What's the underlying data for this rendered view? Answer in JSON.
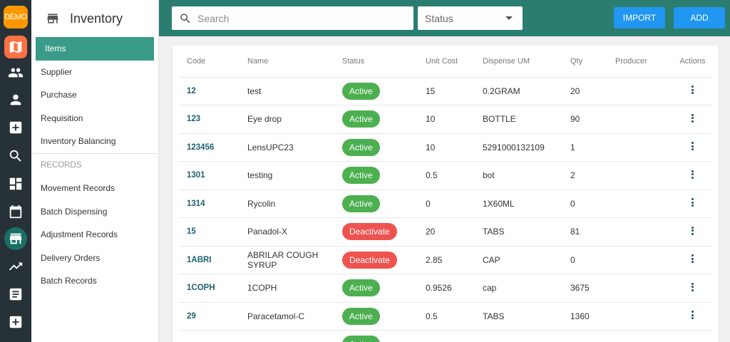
{
  "rail": {
    "demo_label": "DEMO",
    "icons": [
      "map-icon",
      "users-icon",
      "person-icon",
      "medical-plus-icon",
      "search-icon",
      "dashboard-icon",
      "calendar-icon",
      "store-icon",
      "trending-icon",
      "receipt-icon",
      "medical-plus-icon"
    ],
    "active_icon": "store-icon",
    "colors": {
      "rail_bg": "#263238",
      "demo": "#ff9800",
      "map": "#ff7043",
      "active": "#1b6f65"
    }
  },
  "sidebar": {
    "title": "Inventory",
    "items": [
      {
        "label": "Items",
        "active": true
      },
      {
        "label": "Supplier"
      },
      {
        "label": "Purchase"
      },
      {
        "label": "Requisition"
      },
      {
        "label": "Inventory Balancing"
      }
    ],
    "records_section": {
      "label": "RECORDS",
      "items": [
        {
          "label": "Movement Records"
        },
        {
          "label": "Batch Dispensing"
        },
        {
          "label": "Adjustment Records"
        },
        {
          "label": "Delivery Orders"
        },
        {
          "label": "Batch Records"
        }
      ]
    }
  },
  "topbar": {
    "search": {
      "placeholder": "Search",
      "value": ""
    },
    "status_select": {
      "value": "Status"
    },
    "import_label": "IMPORT",
    "add_label": "ADD",
    "colors": {
      "bar": "#2a7d6f",
      "button": "#2196f3"
    }
  },
  "table": {
    "headers": {
      "code": "Code",
      "name": "Name",
      "status": "Status",
      "unit_cost": "Unit Cost",
      "dispense_um": "Dispense UM",
      "qty": "Qty",
      "producer": "Producer",
      "actions": "Actions"
    },
    "rows": [
      {
        "code": "12",
        "name": "test",
        "status": "Active",
        "unit_cost": "15",
        "dispense_um": "0.2GRAM",
        "qty": "20",
        "producer": ""
      },
      {
        "code": "123",
        "name": "Eye drop",
        "status": "Active",
        "unit_cost": "10",
        "dispense_um": "BOTTLE",
        "qty": "90",
        "producer": ""
      },
      {
        "code": "123456",
        "name": "LensUPC23",
        "status": "Active",
        "unit_cost": "10",
        "dispense_um": "5291000132109",
        "qty": "1",
        "producer": ""
      },
      {
        "code": "1301",
        "name": "testing",
        "status": "Active",
        "unit_cost": "0.5",
        "dispense_um": "bot",
        "qty": "2",
        "producer": ""
      },
      {
        "code": "1314",
        "name": "Rycolin",
        "status": "Active",
        "unit_cost": "0",
        "dispense_um": "1X60ML",
        "qty": "0",
        "producer": ""
      },
      {
        "code": "15",
        "name": "Panadol-X",
        "status": "Deactivate",
        "unit_cost": "20",
        "dispense_um": "TABS",
        "qty": "81",
        "producer": ""
      },
      {
        "code": "1ABRI",
        "name": "ABRILAR COUGH SYRUP",
        "status": "Deactivate",
        "unit_cost": "2.85",
        "dispense_um": "CAP",
        "qty": "0",
        "producer": ""
      },
      {
        "code": "1COPH",
        "name": "1COPH",
        "status": "Active",
        "unit_cost": "0.9526",
        "dispense_um": "cap",
        "qty": "3675",
        "producer": ""
      },
      {
        "code": "29",
        "name": "Paracetamol-C",
        "status": "Active",
        "unit_cost": "0.5",
        "dispense_um": "TABS",
        "qty": "1360",
        "producer": ""
      },
      {
        "code": "",
        "name": "",
        "status": "Active",
        "unit_cost": "",
        "dispense_um": "",
        "qty": "",
        "producer": ""
      }
    ],
    "status_colors": {
      "Active": "#4caf50",
      "Deactivate": "#ef5350"
    }
  }
}
